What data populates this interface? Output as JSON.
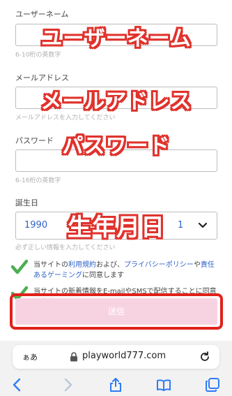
{
  "form": {
    "username": {
      "label": "ユーザーネーム",
      "hint": "6-10桁の英数字",
      "overlay": "ユーザーネーム"
    },
    "email": {
      "label": "メールアドレス",
      "hint": "メールアドレスを入力してください",
      "overlay": "メールアドレス"
    },
    "password": {
      "label": "パスワード",
      "hint": "6-16桁の英数字",
      "overlay": "パスワード"
    },
    "birthday": {
      "label": "誕生日",
      "year": "1990",
      "day": "1",
      "hint": "必ず正しい情報を入力してください",
      "overlay": "生年月日"
    }
  },
  "consents": {
    "terms": {
      "prefix": "当サイトの",
      "link1": "利用規約",
      "mid1": "および、",
      "link2": "プライバシーポリシー",
      "mid2": "や",
      "link3": "責任あるゲーミング",
      "suffix": "に同意します",
      "checked": true
    },
    "newsletter": {
      "text": "当サイトの新着情報をE-mailやSMSで配信することに同意します",
      "checked": true
    }
  },
  "submit": {
    "label": "送信"
  },
  "browser": {
    "text_size_label": "ぁあ",
    "url": "playworld777.com"
  },
  "colors": {
    "accent_red": "#e0221b",
    "link_blue": "#2f63c9",
    "check_green": "#4caf50",
    "submit_pink": "#f7d3e2"
  },
  "icons": [
    "lock-icon",
    "reload-icon",
    "back-icon",
    "forward-icon",
    "share-icon",
    "bookmarks-icon",
    "tabs-icon",
    "chevron-down-icon",
    "checkmark-icon"
  ]
}
